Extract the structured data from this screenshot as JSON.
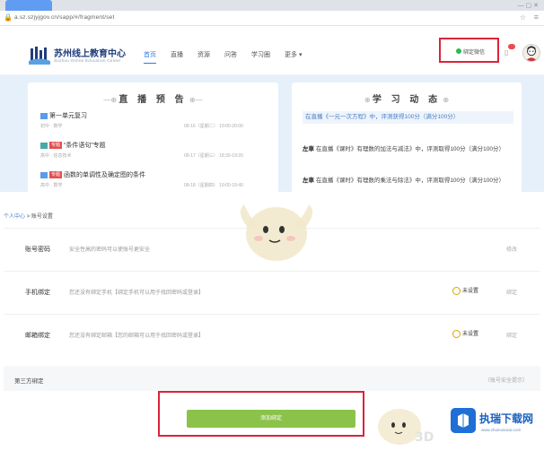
{
  "browser": {
    "url": "a.sz.szjyjgov.cn/sapp/#/fragment/set",
    "tab_dots": "— ▢ ✕"
  },
  "header": {
    "logo_title": "苏州线上教育中心",
    "logo_subtitle": "Suzhou Online Education Center",
    "nav": [
      "首页",
      "直播",
      "资源",
      "问答",
      "学习圈",
      "更多 ▾"
    ],
    "bind_wechat": "绑定微信",
    "colors": {
      "accent": "#2f7ae5",
      "highlight": "#d9243a",
      "wechat": "#2db84d"
    }
  },
  "live_preview": {
    "title": "直 播 预 告",
    "items": [
      {
        "tag": "",
        "title": "第一单元复习",
        "meta": "初中 · 数学",
        "time": "09-16（星期二） 19:00-20:00"
      },
      {
        "tag": "专题",
        "title": "“条件语句”专题",
        "meta": "高中 · 信息技术",
        "time": "09-17（星期三） 18:30-19:20"
      },
      {
        "tag": "专题",
        "title": "函数的单调性及确定图的条件",
        "meta": "高中 · 数学",
        "time": "09-18（星期四） 19:00-19:40"
      }
    ]
  },
  "study_feed": {
    "title": "学 习 动 态",
    "items": [
      {
        "who": "",
        "text": "在直播《一元一次方程》中，评测获得100分（满分100分）"
      },
      {
        "who": "左車",
        "text": "在直播《课时》有理数的加法与减法》中，评测取得100分（满分100分）"
      },
      {
        "who": "左車",
        "text": "在直播《课时》有理数的乘法与除法》中，评测取得100分（满分100分）"
      }
    ]
  },
  "settings": {
    "breadcrumb_home": "个人中心",
    "breadcrumb_current": " > 账号设置",
    "rows": [
      {
        "key": "账号密码",
        "desc": "安全性高的密码可以使账号更安全",
        "status": "",
        "action": "修改"
      },
      {
        "key": "手机绑定",
        "desc": "您还没有绑定手机【绑定手机可以用于找回密码或登录】",
        "status": "未设置",
        "action": "绑定"
      },
      {
        "key": "邮箱绑定",
        "desc": "您还没有绑定邮箱【您的邮箱可以用于找回密码或登录】",
        "status": "未设置",
        "action": "绑定"
      }
    ],
    "third_party_label": "第三方绑定",
    "third_party_more": "（账号安全提示）",
    "bind_button": "添加绑定"
  },
  "watermark": {
    "brand": "执瑞下载网",
    "url": "www.zhuiruxiazai.com",
    "mascot_text": "3D"
  }
}
